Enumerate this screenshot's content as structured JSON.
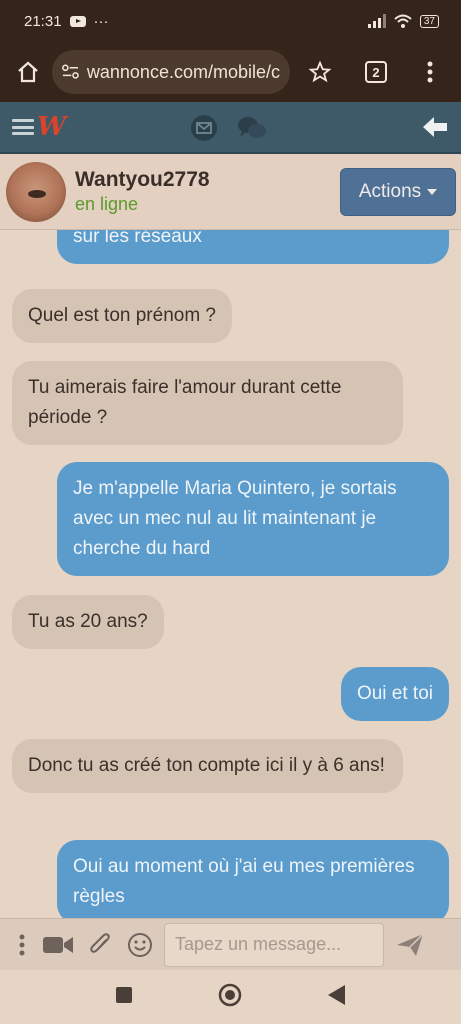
{
  "status_bar": {
    "time": "21:31",
    "dots": "···",
    "battery": "37"
  },
  "browser": {
    "url": "wannonce.com/mobile/c",
    "tab_count": "2"
  },
  "site": {
    "logo": "W"
  },
  "profile": {
    "name": "Wantyou2778",
    "status": "en ligne",
    "actions_label": "Actions"
  },
  "messages": [
    {
      "side": "out",
      "text": "sur les réseaux"
    },
    {
      "side": "in",
      "text": "Quel est ton prénom ?"
    },
    {
      "side": "in",
      "text": "Tu aimerais faire l'amour durant cette période ?"
    },
    {
      "side": "out",
      "text": "Je m'appelle Maria Quintero, je sortais avec un mec nul au lit maintenant je cherche du hard"
    },
    {
      "side": "in",
      "text": "Tu as 20 ans?"
    },
    {
      "side": "out",
      "text": "Oui et toi"
    },
    {
      "side": "in",
      "text": "Donc tu as créé ton compte ici il y à 6 ans!"
    },
    {
      "side": "out",
      "text": "Oui au moment où j'ai eu mes premières règles"
    }
  ],
  "composer": {
    "placeholder": "Tapez un message..."
  },
  "colors": {
    "header_bg": "#3e5968",
    "outgoing_bubble": "#5b9ccd",
    "incoming_bubble": "#d5c3b4",
    "actions_button": "#4f7196",
    "online": "#5b9a2c",
    "logo": "#d9452c"
  }
}
